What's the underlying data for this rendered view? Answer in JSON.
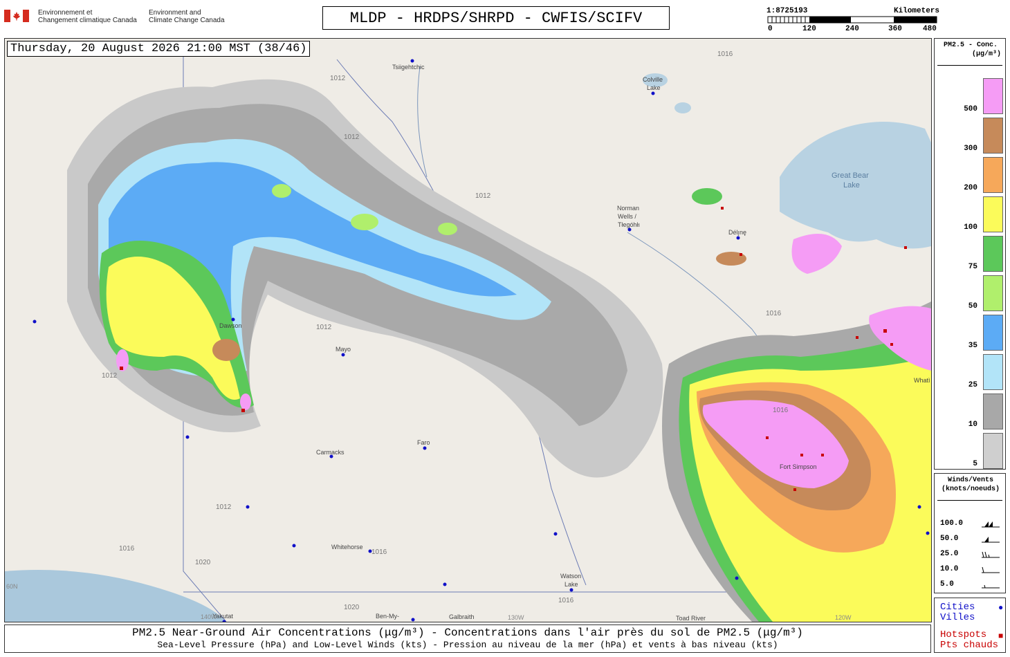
{
  "header": {
    "agency_fr_line1": "Environnement et",
    "agency_fr_line2": "Changement climatique Canada",
    "agency_en_line1": "Environment and",
    "agency_en_line2": "Climate Change Canada",
    "model_title": "MLDP - HRDPS/SHRPD - CWFIS/SCIFV",
    "scale_ratio": "1:8725193",
    "scale_units": "Kilometers",
    "scale_ticks": [
      "0",
      "120",
      "240",
      "360",
      "480"
    ]
  },
  "map": {
    "valid_time": "Thursday, 20 August 2026 21:00 MST (38/46)",
    "places": {
      "tsiigehtchic": "Tsiigehtchic",
      "colville_lake_1": "Colville",
      "colville_lake_2": "Lake",
      "norman_wells_1": "Norman",
      "norman_wells_2": "Wells /",
      "norman_wells_3": "Tłegóhłı",
      "deline": "Délı̨nę",
      "great_bear_lake_1": "Great Bear",
      "great_bear_lake_2": "Lake",
      "dawson": "Dawson",
      "mayo": "Mayo",
      "faro": "Faro",
      "carmacks": "Carmacks",
      "whitehorse": "Whitehorse",
      "watson_lake_1": "Watson",
      "watson_lake_2": "Lake",
      "yakutat": "Yakutat",
      "ben_my": "Ben-My-",
      "galbraith": "Galbraith",
      "toad_river": "Toad River",
      "fort_simpson": "Fort Simpson",
      "whati": "Whatì",
      "lat_60": "60N",
      "lon_140": "140W",
      "lon_130": "130W",
      "lon_120": "120W"
    },
    "isobar_labels": [
      "1012",
      "1016",
      "1020"
    ]
  },
  "legend": {
    "title_line1": "PM2.5 - Conc.",
    "title_line2": "(μg/m³)",
    "bins": [
      {
        "label": "500",
        "color": "#f59cf5"
      },
      {
        "label": "300",
        "color": "#c68a5a"
      },
      {
        "label": "200",
        "color": "#f6a85a"
      },
      {
        "label": "100",
        "color": "#fbfb5a"
      },
      {
        "label": "75",
        "color": "#5cc85a"
      },
      {
        "label": "50",
        "color": "#b0ef6c"
      },
      {
        "label": "35",
        "color": "#5cabf5"
      },
      {
        "label": "25",
        "color": "#b2e4f8"
      },
      {
        "label": "10",
        "color": "#a8a8a8"
      },
      {
        "label": "5",
        "color": "#cfcfcf"
      }
    ]
  },
  "winds": {
    "title_line1": "Winds/Vents",
    "title_line2": "(knots/noeuds)",
    "rows": [
      "100.0",
      "50.0",
      "25.0",
      "10.0",
      "5.0"
    ]
  },
  "key": {
    "cities_en": "Cities",
    "cities_fr": "Villes",
    "cities_color": "#1010c8",
    "hotspots_en": "Hotspots",
    "hotspots_fr": "Pts chauds",
    "hotspots_color": "#c80000"
  },
  "footer": {
    "line1": "PM2.5 Near-Ground Air Concentrations (μg/m³) - Concentrations dans l'air près du sol de PM2.5 (μg/m³)",
    "line2": "Sea-Level Pressure (hPa) and Low-Level Winds (kts) - Pression au niveau de la mer (hPa) et vents à bas niveau (kts)"
  }
}
